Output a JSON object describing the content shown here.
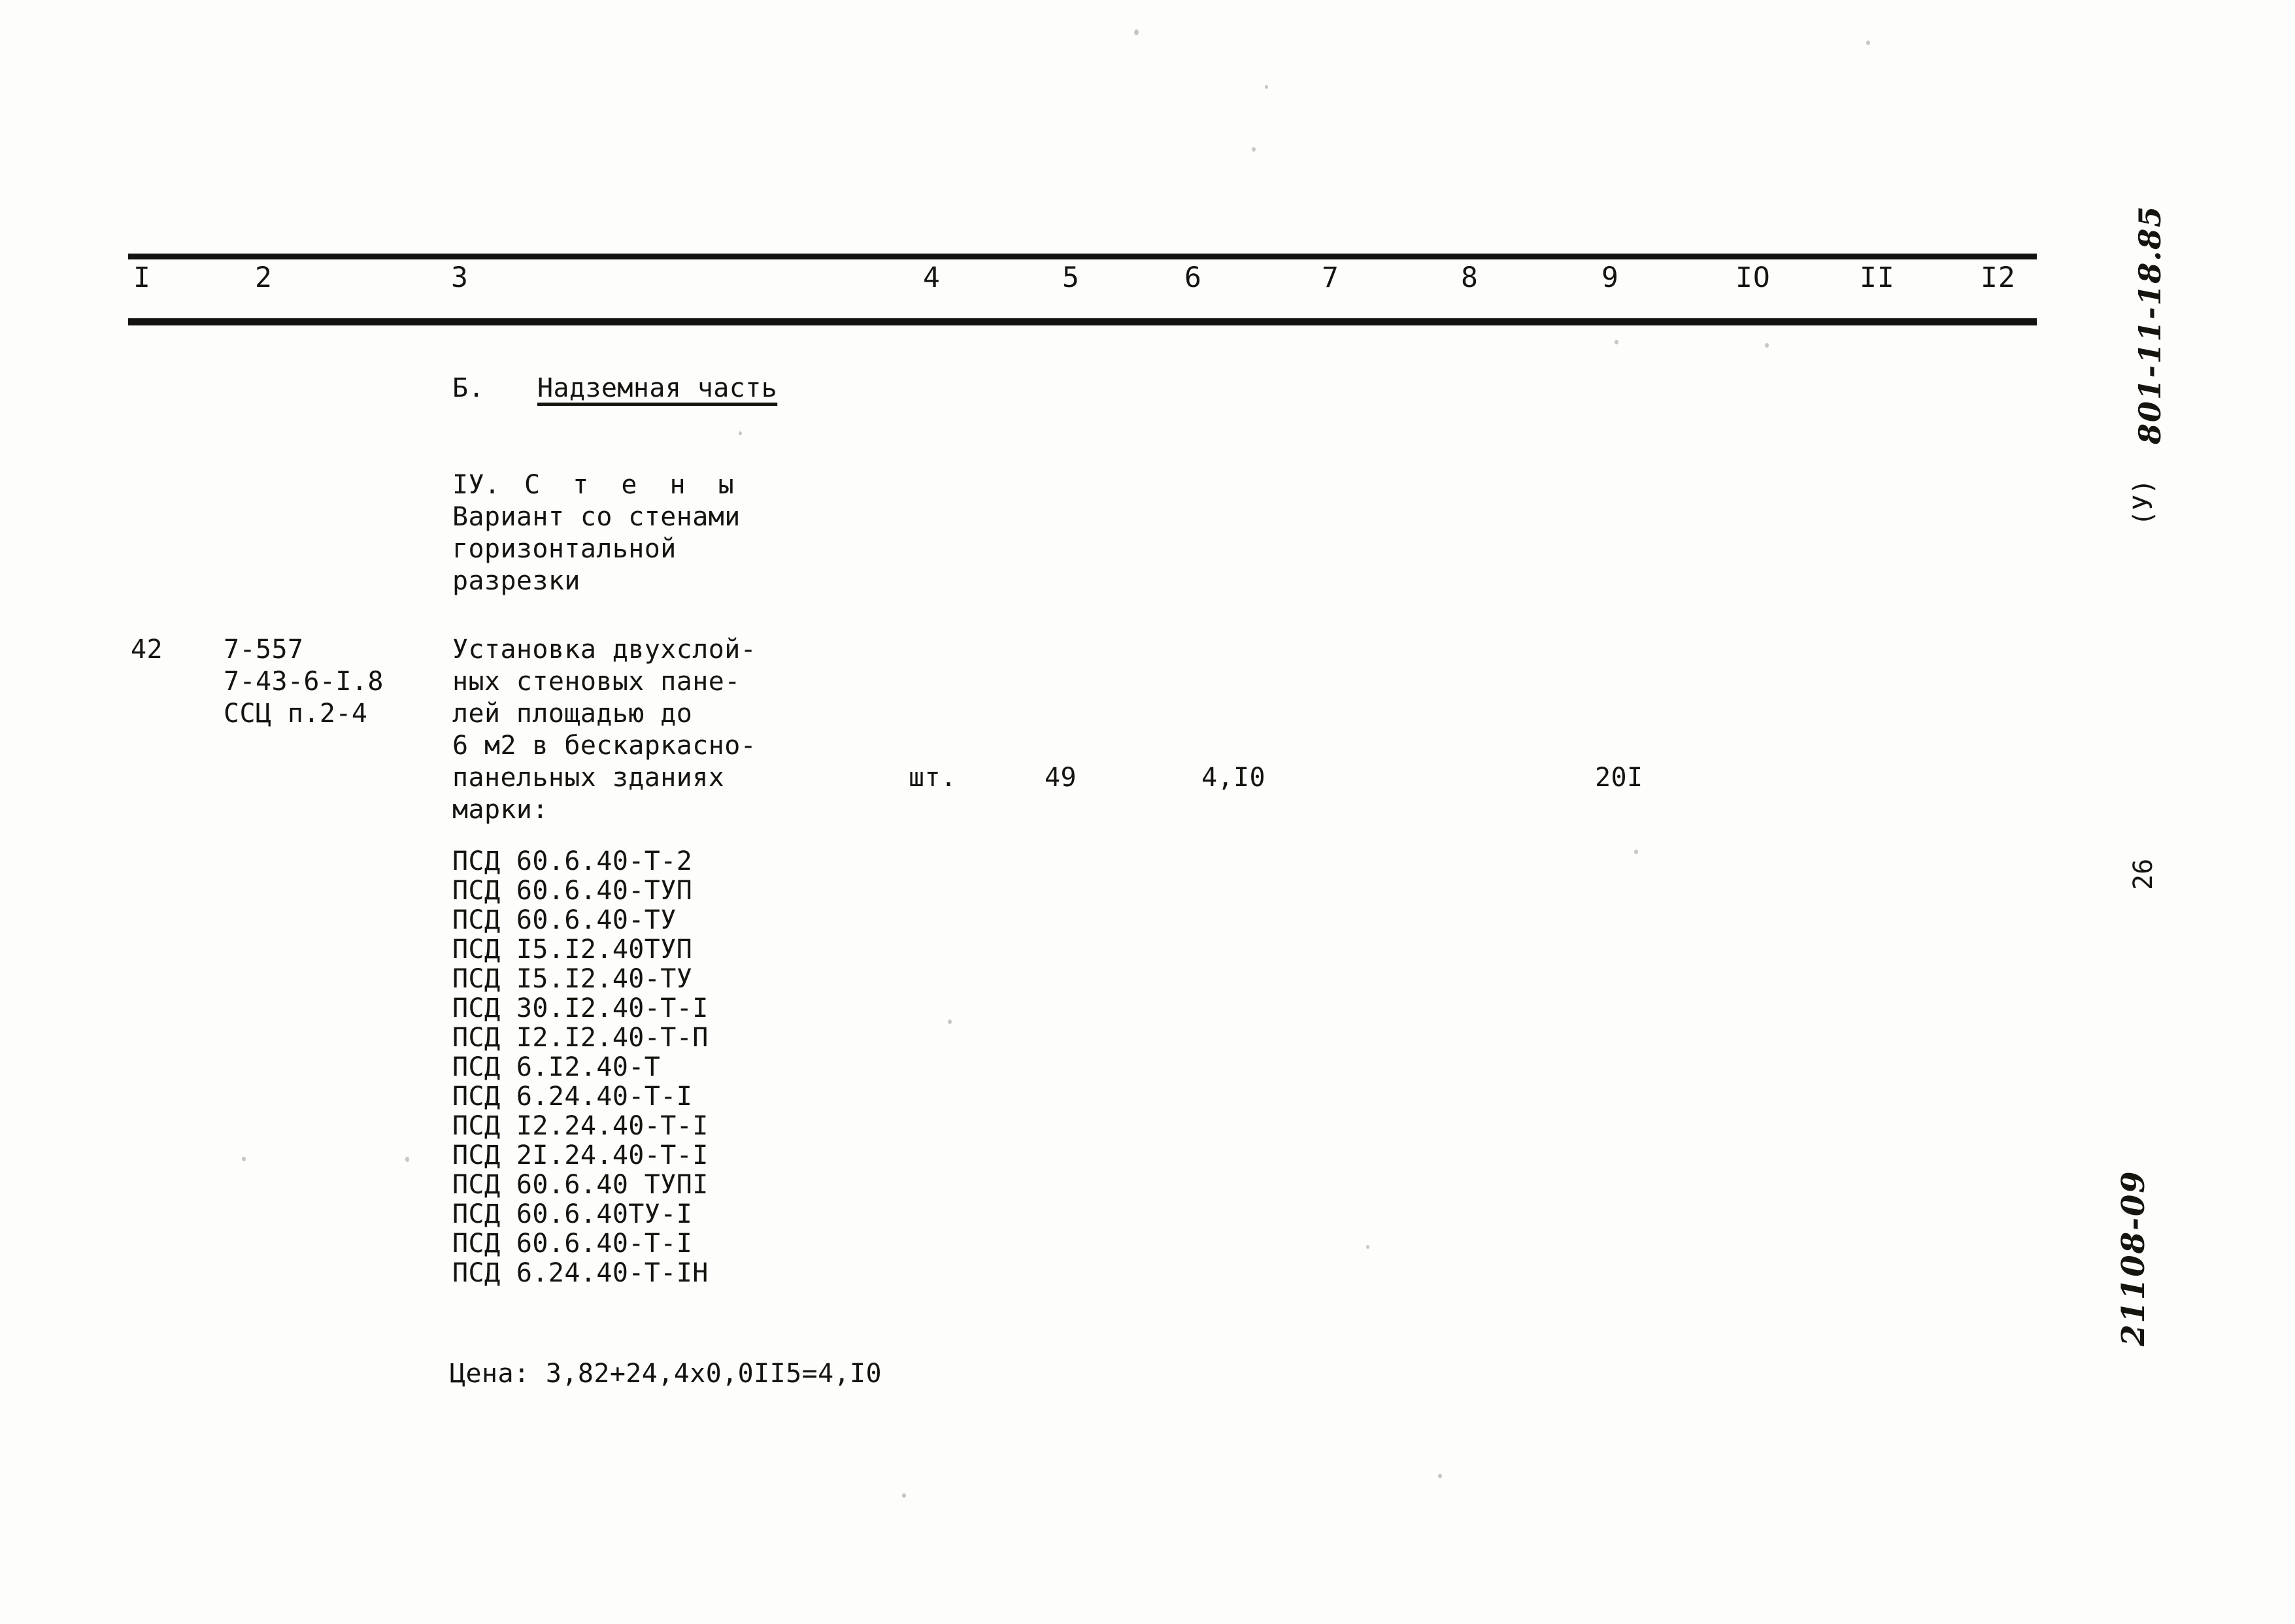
{
  "document": {
    "kind": "scanned-estimate-table-page",
    "column_headers": [
      "I",
      "2",
      "3",
      "4",
      "5",
      "6",
      "7",
      "8",
      "9",
      "IO",
      "II",
      "I2"
    ]
  },
  "section": {
    "letter": "Б.",
    "title": "Надземная часть",
    "roman": "IУ.",
    "roman_title": "С т е н ы",
    "subtitle_lines": [
      "Вариант со стенами",
      "горизонтальной",
      "разрезки"
    ]
  },
  "row": {
    "number": "42",
    "codes": [
      "7-557",
      "7-43-6-I.8",
      "ССЦ п.2-4"
    ],
    "description_lines": [
      "Установка двухслой-",
      "ных стеновых пане-",
      "лей площадью до",
      "6 м2 в бескаркасно-",
      "панельных зданиях",
      "марки:"
    ],
    "unit": "шт.",
    "quantity": "49",
    "unit_price": "4,I0",
    "total": "20I",
    "marks": [
      "ПСД 60.6.40-Т-2",
      "ПСД 60.6.40-ТУП",
      "ПСД 60.6.40-ТУ",
      "ПСД I5.I2.40ТУП",
      "ПСД I5.I2.40-ТУ",
      "ПСД 30.I2.40-Т-I",
      "ПСД I2.I2.40-Т-П",
      "ПСД 6.I2.40-Т",
      "ПСД 6.24.40-Т-I",
      "ПСД I2.24.40-Т-I",
      "ПСД 2I.24.40-Т-I",
      "ПСД 60.6.40 ТУПI",
      "ПСД 60.6.40ТУ-I",
      "ПСД 60.6.40-Т-I",
      "ПСД 6.24.40-Т-IН"
    ],
    "price_formula": "Цена: 3,82+24,4х0,0II5=4,I0"
  },
  "margin": {
    "catalog_code": "801-11-18.85",
    "variant": "(У)",
    "page_number": "26",
    "archive_code": "21108-09"
  }
}
